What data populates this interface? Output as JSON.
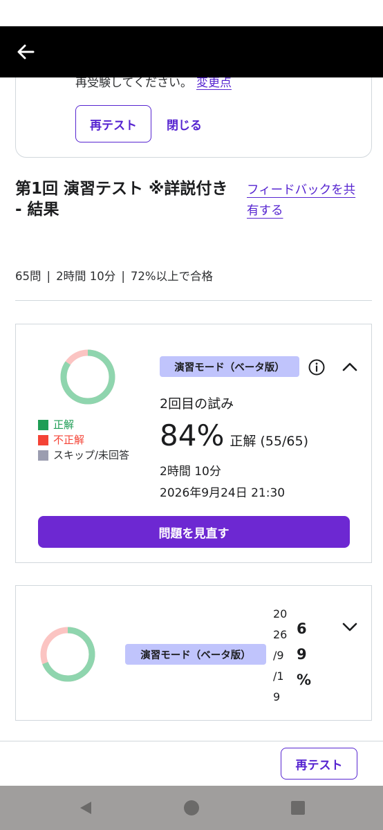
{
  "notice": {
    "text": "再受験してください。",
    "link_label": "変更点",
    "retest_label": "再テスト",
    "close_label": "閉じる"
  },
  "header": {
    "title": "第1回 演習テスト ※詳説付き - 結果",
    "feedback_line1": "フィードバックを共",
    "feedback_line2": "有する"
  },
  "meta": {
    "questions": "65問",
    "duration": "2時間 10分",
    "pass": "72%以上で合格"
  },
  "attempt1": {
    "mode_badge": "演習モード（ベータ版）",
    "attempt_label": "2回目の試み",
    "score_pct": "84%",
    "score_detail": "正解 (55/65)",
    "duration": "2時間 10分",
    "datetime": "2026年9月24日 21:30",
    "review_label": "問題を見直す",
    "correct_fraction": 0.846,
    "legend": [
      {
        "label": "正解",
        "color": "#1f9d55"
      },
      {
        "label": "不正解",
        "color": "#f44336"
      },
      {
        "label": "スキップ/未回答",
        "color": "#9b9db0"
      }
    ]
  },
  "attempt2": {
    "mode_badge": "演習モード（ベータ版）",
    "date_lines": [
      "20",
      "26",
      "/9",
      "/1",
      "9"
    ],
    "pct_lines": [
      "6",
      "9",
      "%"
    ],
    "correct_fraction": 0.69
  },
  "footer": {
    "retest_label": "再テスト"
  },
  "colors": {
    "accent": "#5624d0",
    "primary_button": "#6d28d2",
    "badge_bg": "#c0c4fc",
    "donut_correct": "#8fd5ae",
    "donut_incorrect": "#fbc4c2"
  }
}
